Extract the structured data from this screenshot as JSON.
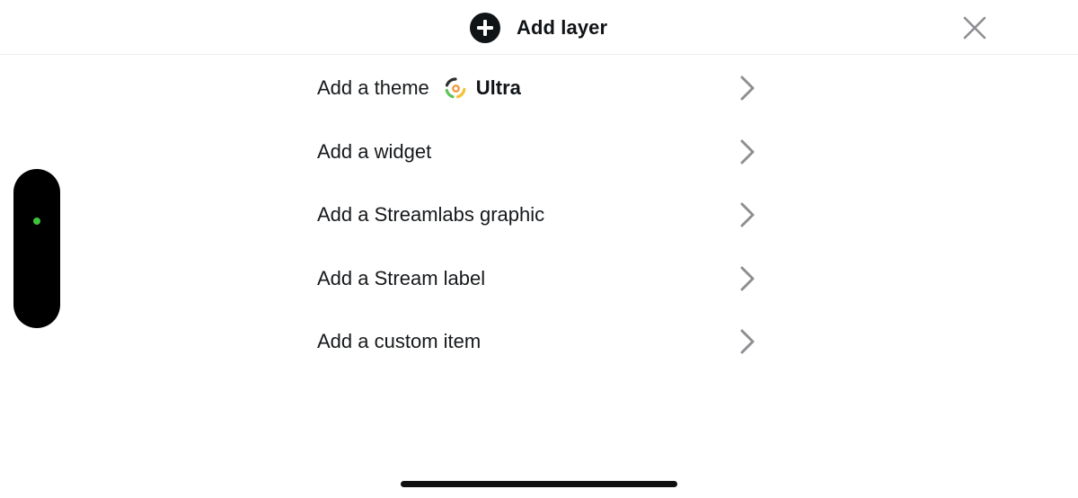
{
  "header": {
    "title": "Add layer",
    "add_icon": "plus-circle-icon",
    "close_icon": "close-icon"
  },
  "menu": {
    "items": [
      {
        "label": "Add a theme",
        "badge": "Ultra",
        "badge_icon": "ultra-ring-icon"
      },
      {
        "label": "Add a widget"
      },
      {
        "label": "Add a Streamlabs graphic"
      },
      {
        "label": "Add a Stream label"
      },
      {
        "label": "Add a custom item"
      }
    ],
    "chevron_icon": "chevron-right-icon"
  },
  "colors": {
    "text": "#111417",
    "chevron": "#8e8e93",
    "status_dot": "#3ec43c",
    "divider": "#ececec"
  }
}
